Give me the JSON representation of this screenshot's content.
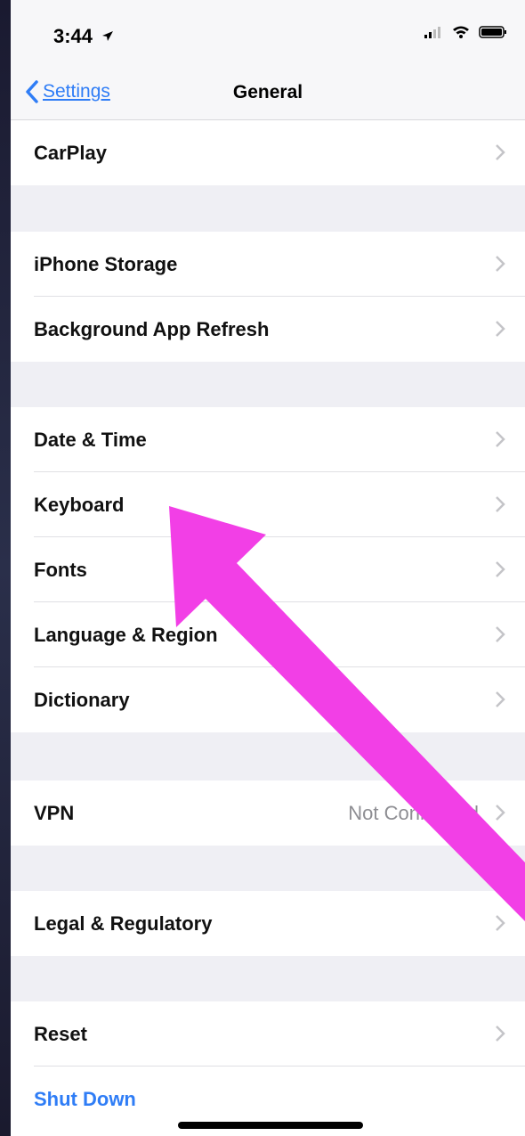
{
  "status_bar": {
    "time": "3:44"
  },
  "nav": {
    "back_label": "Settings",
    "title": "General"
  },
  "rows": {
    "carplay": "CarPlay",
    "iphone_storage": "iPhone Storage",
    "background_refresh": "Background App Refresh",
    "date_time": "Date & Time",
    "keyboard": "Keyboard",
    "fonts": "Fonts",
    "language_region": "Language & Region",
    "dictionary": "Dictionary",
    "vpn": "VPN",
    "vpn_status": "Not Connected",
    "legal": "Legal & Regulatory",
    "reset": "Reset",
    "shut_down": "Shut Down"
  },
  "colors": {
    "accent": "#2f7df6",
    "annotation_arrow": "#f23fe6",
    "background": "#efeff4"
  },
  "icons": [
    "location-arrow-icon",
    "signal-icon",
    "wifi-icon",
    "battery-icon",
    "chevron-left-icon",
    "chevron-right-icon"
  ]
}
